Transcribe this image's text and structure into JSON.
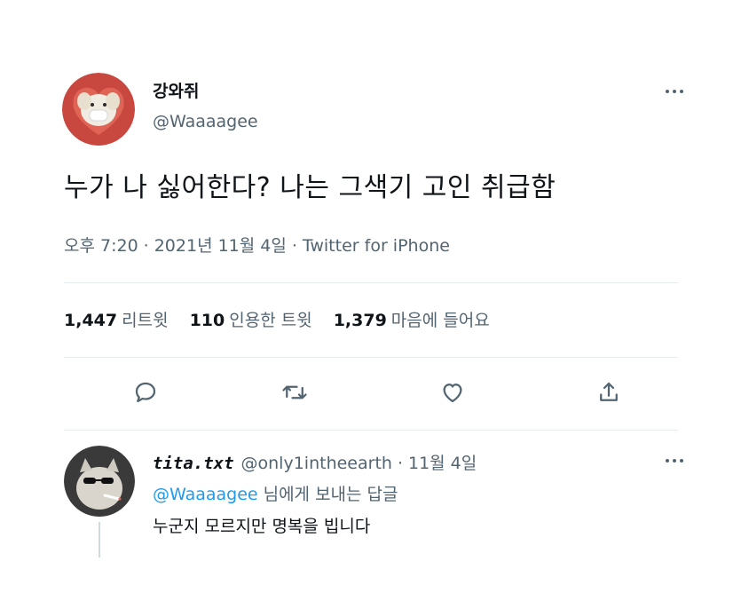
{
  "tweet": {
    "author_name": "강와쥐",
    "author_handle": "@Waaaagee",
    "text": "누가 나 싫어한다? 나는 그색기 고인 취급함",
    "time": "오후 7:20",
    "date": "2021년 11월 4일",
    "source": "Twitter for iPhone",
    "separator": "·"
  },
  "stats": [
    {
      "count": "1,447",
      "label": "리트윗"
    },
    {
      "count": "110",
      "label": "인용한 트윗"
    },
    {
      "count": "1,379",
      "label": "마음에 들어요"
    }
  ],
  "actions": {
    "reply_icon": "reply-icon",
    "retweet_icon": "retweet-icon",
    "like_icon": "heart-icon",
    "share_icon": "share-icon"
  },
  "reply": {
    "author_name": "tita.txt",
    "author_handle": "@only1intheearth",
    "separator": "·",
    "date": "11월 4일",
    "replying_to_handle": "@Waaaagee",
    "replying_to_suffix": "님에게 보내는 답글",
    "text": "누군지 모르지만 명복을 빕니다"
  },
  "colors": {
    "text": "#0f1419",
    "secondary": "#536471",
    "accent": "#1d9bf0",
    "divider": "#e6ecf0",
    "avatar_bg": "#c8483f"
  }
}
